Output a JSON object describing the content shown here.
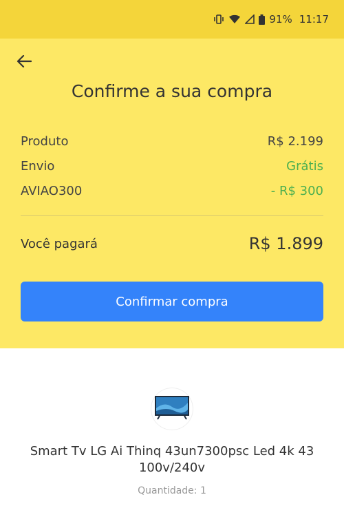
{
  "status_bar": {
    "battery_percent": "91%",
    "time": "11:17",
    "icons": [
      "vibrate-icon",
      "wifi-icon",
      "signal-icon",
      "battery-icon"
    ]
  },
  "header": {
    "back_icon": "arrow-left-icon",
    "title": "Confirme a sua compra"
  },
  "summary": {
    "rows": [
      {
        "label": "Produto",
        "value": "R$ 2.199",
        "color": "#444444"
      },
      {
        "label": "Envio",
        "value": "Grátis",
        "color": "#4caf50"
      },
      {
        "label": "AVIAO300",
        "value": "- R$ 300",
        "color": "#4caf50"
      }
    ],
    "total_label": "Você pagará",
    "total_value": "R$ 1.899"
  },
  "actions": {
    "confirm_label": "Confirmar compra"
  },
  "product": {
    "thumbnail_icon": "tv-icon",
    "name": "Smart Tv LG Ai Thinq 43un7300psc Led 4k 43 100v/240v",
    "quantity": "Quantidade: 1"
  },
  "colors": {
    "status_bar_bg": "#f4d53a",
    "panel_bg": "#fde865",
    "primary_button": "#3483fa",
    "discount_green": "#4caf50"
  }
}
